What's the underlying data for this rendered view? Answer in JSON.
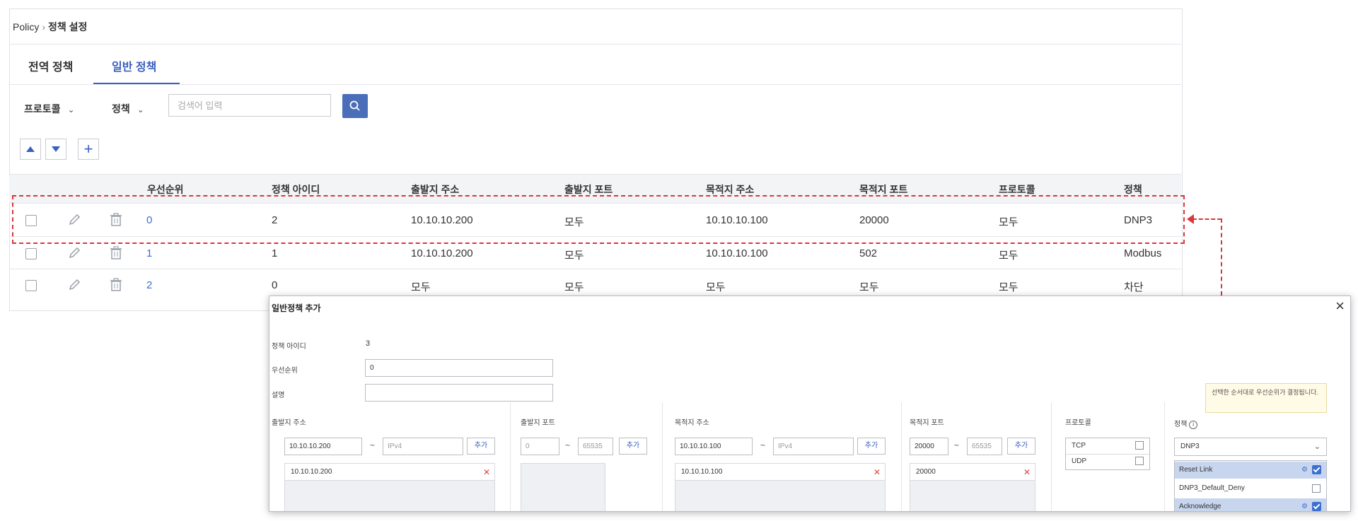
{
  "breadcrumb": {
    "root": "Policy",
    "separator": "›",
    "current": "정책 설정"
  },
  "tabs": [
    {
      "label": "전역 정책",
      "active": false
    },
    {
      "label": "일반 정책",
      "active": true
    }
  ],
  "filters": {
    "protocol_label": "프로토콜",
    "policy_label": "정책",
    "search_placeholder": "검색어 입력"
  },
  "table": {
    "columns": [
      "우선순위",
      "정책 아이디",
      "출발지 주소",
      "출발지 포트",
      "목적지 주소",
      "목적지 포트",
      "프로토콜",
      "정책"
    ],
    "rows": [
      {
        "priority": "0",
        "policy_id": "2",
        "src_addr": "10.10.10.200",
        "src_port": "모두",
        "dst_addr": "10.10.10.100",
        "dst_port": "20000",
        "protocol": "모두",
        "policy": "DNP3"
      },
      {
        "priority": "1",
        "policy_id": "1",
        "src_addr": "10.10.10.200",
        "src_port": "모두",
        "dst_addr": "10.10.10.100",
        "dst_port": "502",
        "protocol": "모두",
        "policy": "Modbus"
      },
      {
        "priority": "2",
        "policy_id": "0",
        "src_addr": "모두",
        "src_port": "모두",
        "dst_addr": "모두",
        "dst_port": "모두",
        "protocol": "모두",
        "policy": "차단"
      }
    ]
  },
  "dialog": {
    "title": "일반정책 추가",
    "policy_id_label": "정책 아이디",
    "policy_id_value": "3",
    "priority_label": "우선순위",
    "priority_value": "0",
    "description_label": "설명",
    "description_value": "",
    "src_addr": {
      "label": "출발지 주소",
      "from": "10.10.10.200",
      "to_placeholder": "IPv4",
      "add_label": "추가",
      "entries": [
        "10.10.10.200"
      ]
    },
    "src_port": {
      "label": "출발지 포트",
      "from_placeholder": "0",
      "to_placeholder": "65535",
      "add_label": "추가"
    },
    "dst_addr": {
      "label": "목적지 주소",
      "from": "10.10.10.100",
      "to_placeholder": "IPv4",
      "add_label": "추가",
      "entries": [
        "10.10.10.100"
      ]
    },
    "dst_port": {
      "label": "목적지 포트",
      "from": "20000",
      "to_placeholder": "65535",
      "add_label": "추가",
      "entries": [
        "20000"
      ]
    },
    "protocol": {
      "label": "프로토콜",
      "options": [
        "TCP",
        "UDP"
      ]
    },
    "policy": {
      "label": "정책",
      "selected": "DNP3",
      "tooltip": "선택한 순서대로 우선순위가 결정됩니다.",
      "items": [
        {
          "label": "Reset Link",
          "checked": true,
          "highlight": true
        },
        {
          "label": "DNP3_Default_Deny",
          "checked": false,
          "highlight": false
        },
        {
          "label": "Acknowledge",
          "checked": true,
          "highlight": true
        }
      ]
    }
  },
  "colors": {
    "accent": "#3b5fbf",
    "annotation": "#d9363e",
    "link": "#3b6fd0"
  }
}
